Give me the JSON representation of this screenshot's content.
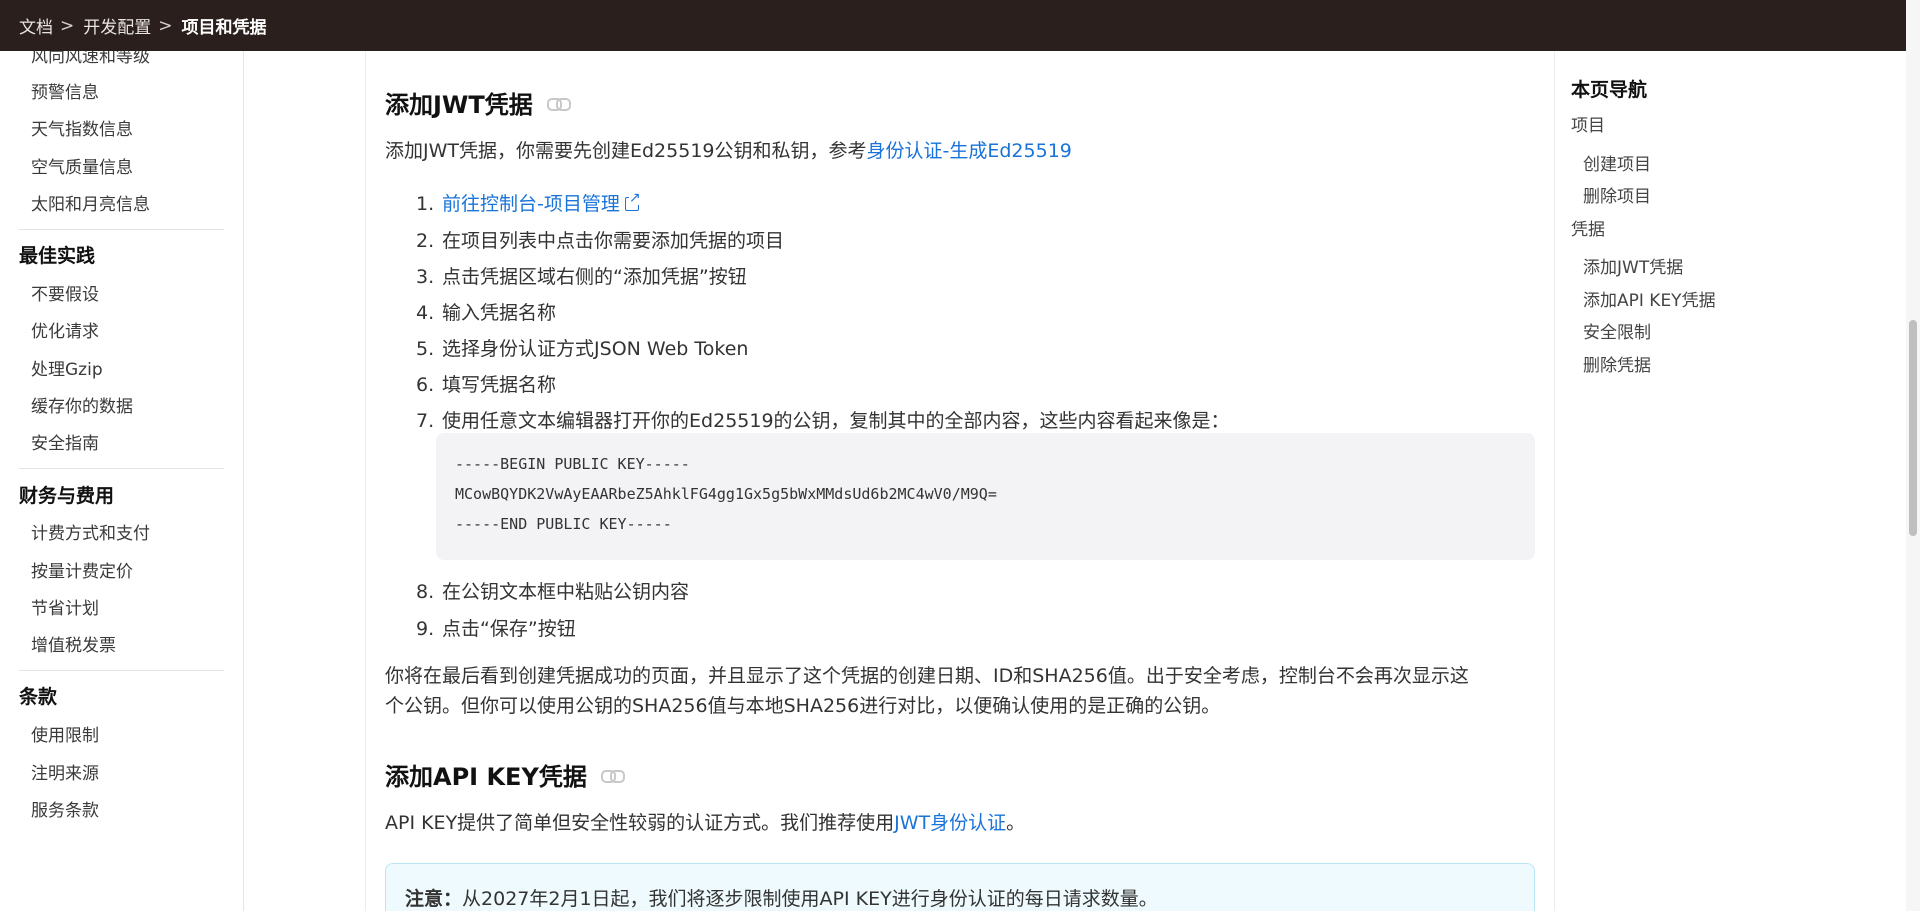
{
  "breadcrumb": {
    "items": [
      "文档",
      "开发配置",
      "项目和凭据"
    ],
    "separator": ">"
  },
  "sidebar": {
    "items_top": [
      "风向风速和等级",
      "预警信息",
      "天气指数信息",
      "空气质量信息",
      "太阳和月亮信息"
    ],
    "group_best": {
      "title": "最佳实践",
      "items": [
        "不要假设",
        "优化请求",
        "处理Gzip",
        "缓存你的数据",
        "安全指南"
      ]
    },
    "group_finance": {
      "title": "财务与费用",
      "items": [
        "计费方式和支付",
        "按量计费定价",
        "节省计划",
        "增值税发票"
      ]
    },
    "group_terms": {
      "title": "条款",
      "items": [
        "使用限制",
        "注明来源",
        "服务条款"
      ]
    }
  },
  "main": {
    "jwt": {
      "heading": "添加JWT凭据",
      "intro_prefix": "添加JWT凭据，你需要先创建Ed25519公钥和私钥，参考",
      "intro_link": "身份认证-生成Ed25519",
      "steps": [
        {
          "num": "1.",
          "text": "前往控制台-项目管理"
        },
        {
          "num": "2.",
          "text": "在项目列表中点击你需要添加凭据的项目"
        },
        {
          "num": "3.",
          "text": "点击凭据区域右侧的“添加凭据”按钮"
        },
        {
          "num": "4.",
          "text": "输入凭据名称"
        },
        {
          "num": "5.",
          "text": "选择身份认证方式JSON Web Token"
        },
        {
          "num": "6.",
          "text": "填写凭据名称"
        },
        {
          "num": "7.",
          "text": "使用任意文本编辑器打开你的Ed25519的公钥，复制其中的全部内容，这些内容看起来像是："
        },
        {
          "num": "8.",
          "text": "在公钥文本框中粘贴公钥内容"
        },
        {
          "num": "9.",
          "text": "点击“保存”按钮"
        }
      ],
      "code_lines": [
        "-----BEGIN PUBLIC KEY-----",
        "MCowBQYDK2VwAyEAARbeZ5AhklFG4gg1Gx5g5bWxMMdsUd6b2MC4wV0/M9Q=",
        "-----END PUBLIC KEY-----"
      ],
      "outro_line1": "你将在最后看到创建凭据成功的页面，并且显示了这个凭据的创建日期、ID和SHA256值。出于安全考虑，控制台不会再次显示这",
      "outro_line2": "个公钥。但你可以使用公钥的SHA256值与本地SHA256进行对比，以便确认使用的是正确的公钥。"
    },
    "apikey": {
      "heading": "添加API KEY凭据",
      "intro_prefix": "API KEY提供了简单但安全性较弱的认证方式。我们推荐使用",
      "intro_link": "JWT身份认证",
      "intro_suffix": "。",
      "note_label": "注意：",
      "note_text": "从2027年2月1日起，我们将逐步限制使用API KEY进行身份认证的每日请求数量。"
    }
  },
  "toc": {
    "title": "本页导航",
    "sections": [
      {
        "label": "项目",
        "children": [
          "创建项目",
          "删除项目"
        ]
      },
      {
        "label": "凭据",
        "children": [
          "添加JWT凭据",
          "添加API KEY凭据",
          "安全限制",
          "删除凭据"
        ]
      }
    ]
  },
  "colors": {
    "topbar": "#2a1f1c",
    "link": "#1a73d9",
    "note_bg": "#eefafd",
    "code_bg": "#f3f3f5"
  }
}
